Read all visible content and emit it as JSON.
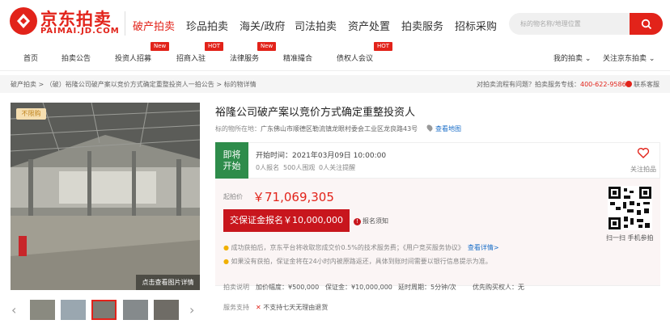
{
  "header": {
    "logo_cn": "京东拍卖",
    "logo_en": "PAIMAI.JD.COM",
    "nav": [
      "破产拍卖",
      "珍品拍卖",
      "海关/政府",
      "司法拍卖",
      "资产处置",
      "拍卖服务",
      "招标采购"
    ],
    "search_placeholder": "标的物名称/地理位置"
  },
  "subnav": {
    "items": [
      "首页",
      "拍卖公告",
      "投资人招募",
      "招商入驻",
      "法律服务",
      "精准撮合",
      "债权人会议"
    ],
    "tags": {
      "investor": "New",
      "merchant": "HOT",
      "legal": "New",
      "creditor": "HOT"
    },
    "my_auction": "我的拍卖",
    "follow": "关注京东拍卖"
  },
  "breadcrumb": {
    "items": [
      "破产拍卖",
      "（破）裕隆公司破产案以竞价方式确定重整投资人一拍公告",
      "标的物详情"
    ],
    "sep": ">",
    "help": "对拍卖流程有问题？拍卖服务专线：",
    "phone": "400-622-9586",
    "contact": "联系客服"
  },
  "gallery": {
    "badge": "不限购",
    "view_large": "点击查看图片详情"
  },
  "item": {
    "title": "裕隆公司破产案以竞价方式确定重整投资人",
    "location_label": "标的物所在地：",
    "location": "广东佛山市顺德区勒流镇龙眼村委会工业区龙良路43号",
    "map_link": "查看地图"
  },
  "status": {
    "badge_line1": "即将",
    "badge_line2": "开始",
    "start_time": "开始时间：2021年03月09日 10:00:00",
    "stats": [
      "0人报名",
      "500人围观",
      "0人关注提醒"
    ],
    "follow": "关注拍品"
  },
  "bid": {
    "start_label": "起拍价",
    "start_price": "￥71,069,305",
    "deposit_button": "交保证金报名￥10,000,000",
    "notice": "报名须知",
    "qr_caption": "扫一扫 手机参拍"
  },
  "notes": {
    "line1": "成功获拍后，京东平台将收取您成交价0.5%的技术服务费；《用户竞买服务协议》",
    "line1_link": "查看详情>",
    "line2": "如果没有获拍，保证金将在24小时内被原路返还，具体到账时间需要以银行信息提示为准。"
  },
  "auction_info": {
    "label": "拍卖说明",
    "items": [
      "加价幅度：¥500,000",
      "保证金：¥10,000,000",
      "延时周期：5分钟/次",
      "优先购买权人：无"
    ]
  },
  "service": {
    "label": "服务支持",
    "text": "不支持七天无理由退货"
  },
  "colors": {
    "brand": "#e2231a",
    "green": "#2e8c4b",
    "link": "#1a6ec8"
  }
}
